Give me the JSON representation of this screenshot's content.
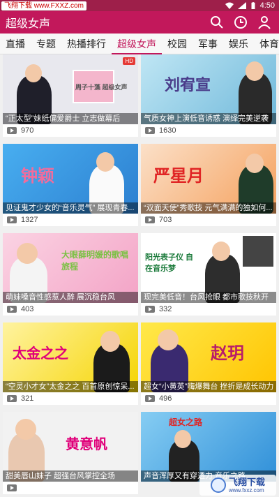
{
  "status": {
    "watermark": "飞翔下载 www.FXXZ.com",
    "time": "4:50"
  },
  "appbar": {
    "title": "超级女声"
  },
  "tabs": [
    {
      "label": "直播",
      "active": false
    },
    {
      "label": "专题",
      "active": false
    },
    {
      "label": "热播排行",
      "active": false
    },
    {
      "label": "超级女声",
      "active": true
    },
    {
      "label": "校园",
      "active": false
    },
    {
      "label": "军事",
      "active": false
    },
    {
      "label": "娱乐",
      "active": false
    },
    {
      "label": "体育",
      "active": false
    }
  ],
  "videos": [
    {
      "caption": "“正太型”妹纸偏爱爵士 立志做幕后",
      "plays": "970",
      "poster": "周子十藻 超级女声",
      "theme": "#e8e8ee",
      "accent": "#555"
    },
    {
      "caption": "气质女神上演低音诱惑 演绎完美逆袭",
      "plays": "1630",
      "poster": "刘宥宣",
      "theme": "#8fd0ea",
      "accent": "#4a3c8a"
    },
    {
      "caption": "见证鬼才少女的“音乐灵气” 展现青春...",
      "plays": "1327",
      "poster": "钟颖",
      "theme": "#3aa0e0",
      "accent": "#f26c9c"
    },
    {
      "caption": "“双面天使”秀歌技 元气满满的独如何...",
      "plays": "703",
      "poster": "严星月",
      "theme": "#f07a2c",
      "accent": "#e02424"
    },
    {
      "caption": "萌妹嗓音性感惹人醉 展沉稳台风",
      "plays": "403",
      "poster": "大眼薛明媛的歌唱旅程",
      "theme": "#f7a8c9",
      "accent": "#7ac143"
    },
    {
      "caption": "现完美低音！台风抢眼 都市歌技秋开",
      "plays": "332",
      "poster": "阳光表子仪 自在音乐梦",
      "theme": "#ffffff",
      "accent": "#1a7a3a"
    },
    {
      "caption": "“空灵小才女”太金之之 百首原创惊呆...",
      "plays": "321",
      "poster": "太金之之",
      "theme": "#f5d400",
      "accent": "#e0007a"
    },
    {
      "caption": "超女“小黄英”嗨爆舞台 挫折是成长动力",
      "plays": "496",
      "poster": "赵玥",
      "theme": "#ffdd00",
      "accent": "#b81c6a"
    },
    {
      "caption": "甜美唇山妹子 超强台风掌控全场",
      "plays": "",
      "poster": "黄意帆",
      "theme": "#f2f2f2",
      "accent": "#e0007a"
    },
    {
      "caption": "声音浑厚又有穿透力 音乐之路",
      "plays": "",
      "poster": "超女之路",
      "theme": "#3fa6e8",
      "accent": "#e02424"
    }
  ],
  "watermark": {
    "brand": "飞翔下载",
    "url": "www.fxxz.com"
  }
}
